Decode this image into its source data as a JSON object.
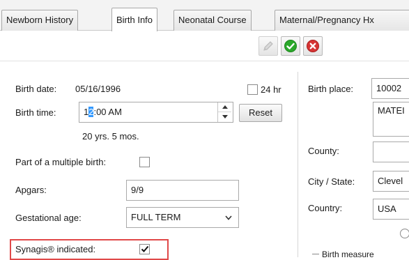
{
  "tabs": [
    {
      "label": "Newborn History",
      "active": false
    },
    {
      "label": "Birth Info",
      "active": true
    },
    {
      "label": "Neonatal Course",
      "active": false
    },
    {
      "label": "Maternal/Pregnancy Hx",
      "active": false
    }
  ],
  "toolbar": {
    "edit_icon": "pencil-icon",
    "confirm_icon": "green-check-icon",
    "cancel_icon": "red-x-icon"
  },
  "birth": {
    "date_label": "Birth date:",
    "date_value": "05/16/1996",
    "hr24_label": "24 hr",
    "hr24_checked": false,
    "time_label": "Birth time:",
    "time_sel": "1",
    "time_rest": ":00 AM",
    "time_caret_char": "2",
    "reset_label": "Reset",
    "age_text": "20 yrs. 5 mos.",
    "multiple_label": "Part of a multiple birth:",
    "multiple_checked": false,
    "apgars_label": "Apgars:",
    "apgars_value": "9/9",
    "gest_label": "Gestational age:",
    "gest_value": "FULL TERM",
    "synagis_label": "Synagis® indicated:",
    "synagis_checked": true
  },
  "place": {
    "place_label": "Birth place:",
    "place_value": "10002",
    "place_name": "MATEI",
    "county_label": "County:",
    "county_value": "",
    "city_label": "City / State:",
    "city_value": "Clevel",
    "country_label": "Country:",
    "country_value": "USA",
    "measures_label": "Birth measure"
  },
  "colors": {
    "highlight": "#e04848",
    "confirm": "#2aa82a",
    "cancel": "#d63333"
  }
}
